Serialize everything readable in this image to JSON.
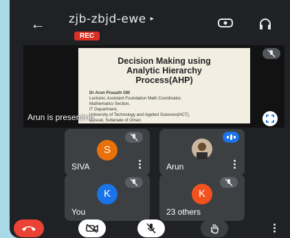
{
  "meeting": {
    "code": "zjb-zbjd-ewe",
    "rec_label": "REC"
  },
  "slide": {
    "title_line1": "Decision Making using",
    "title_line2": "Analytic Hierarchy",
    "title_line3": "Process(AHP)",
    "body": [
      "Dr Arun Prasath GM",
      "Lecturer, Assistant Foundation Math Coordinator,",
      "Mathematics Section,",
      "IT Department,",
      "University of Technology and Applied Sciences(HCT),",
      "Muscat, Sultanate of Oman"
    ]
  },
  "presenter": {
    "label": "Arun is presenting"
  },
  "tiles": [
    {
      "name": "SIVA",
      "initial": "S",
      "color": "#e8710a",
      "muted": true
    },
    {
      "name": "Arun",
      "initial": "",
      "color": "#5f6368",
      "muted": false,
      "speaking": true
    },
    {
      "name": "You",
      "initial": "K",
      "color": "#1a73e8",
      "muted": true
    },
    {
      "name": "23 others",
      "initial": "K",
      "color": "#f4511e",
      "muted": true
    }
  ],
  "colors": {
    "background": "#202124",
    "hangup": "#ea4335",
    "rec": "#d93025",
    "accent_blue": "#1a73e8"
  },
  "icons": [
    "back-arrow-icon",
    "chevron-right-icon",
    "switch-camera-icon",
    "headset-icon",
    "mic-off-icon",
    "expand-icon",
    "more-vert-icon",
    "hang-up-icon",
    "camera-off-icon",
    "raise-hand-icon"
  ]
}
